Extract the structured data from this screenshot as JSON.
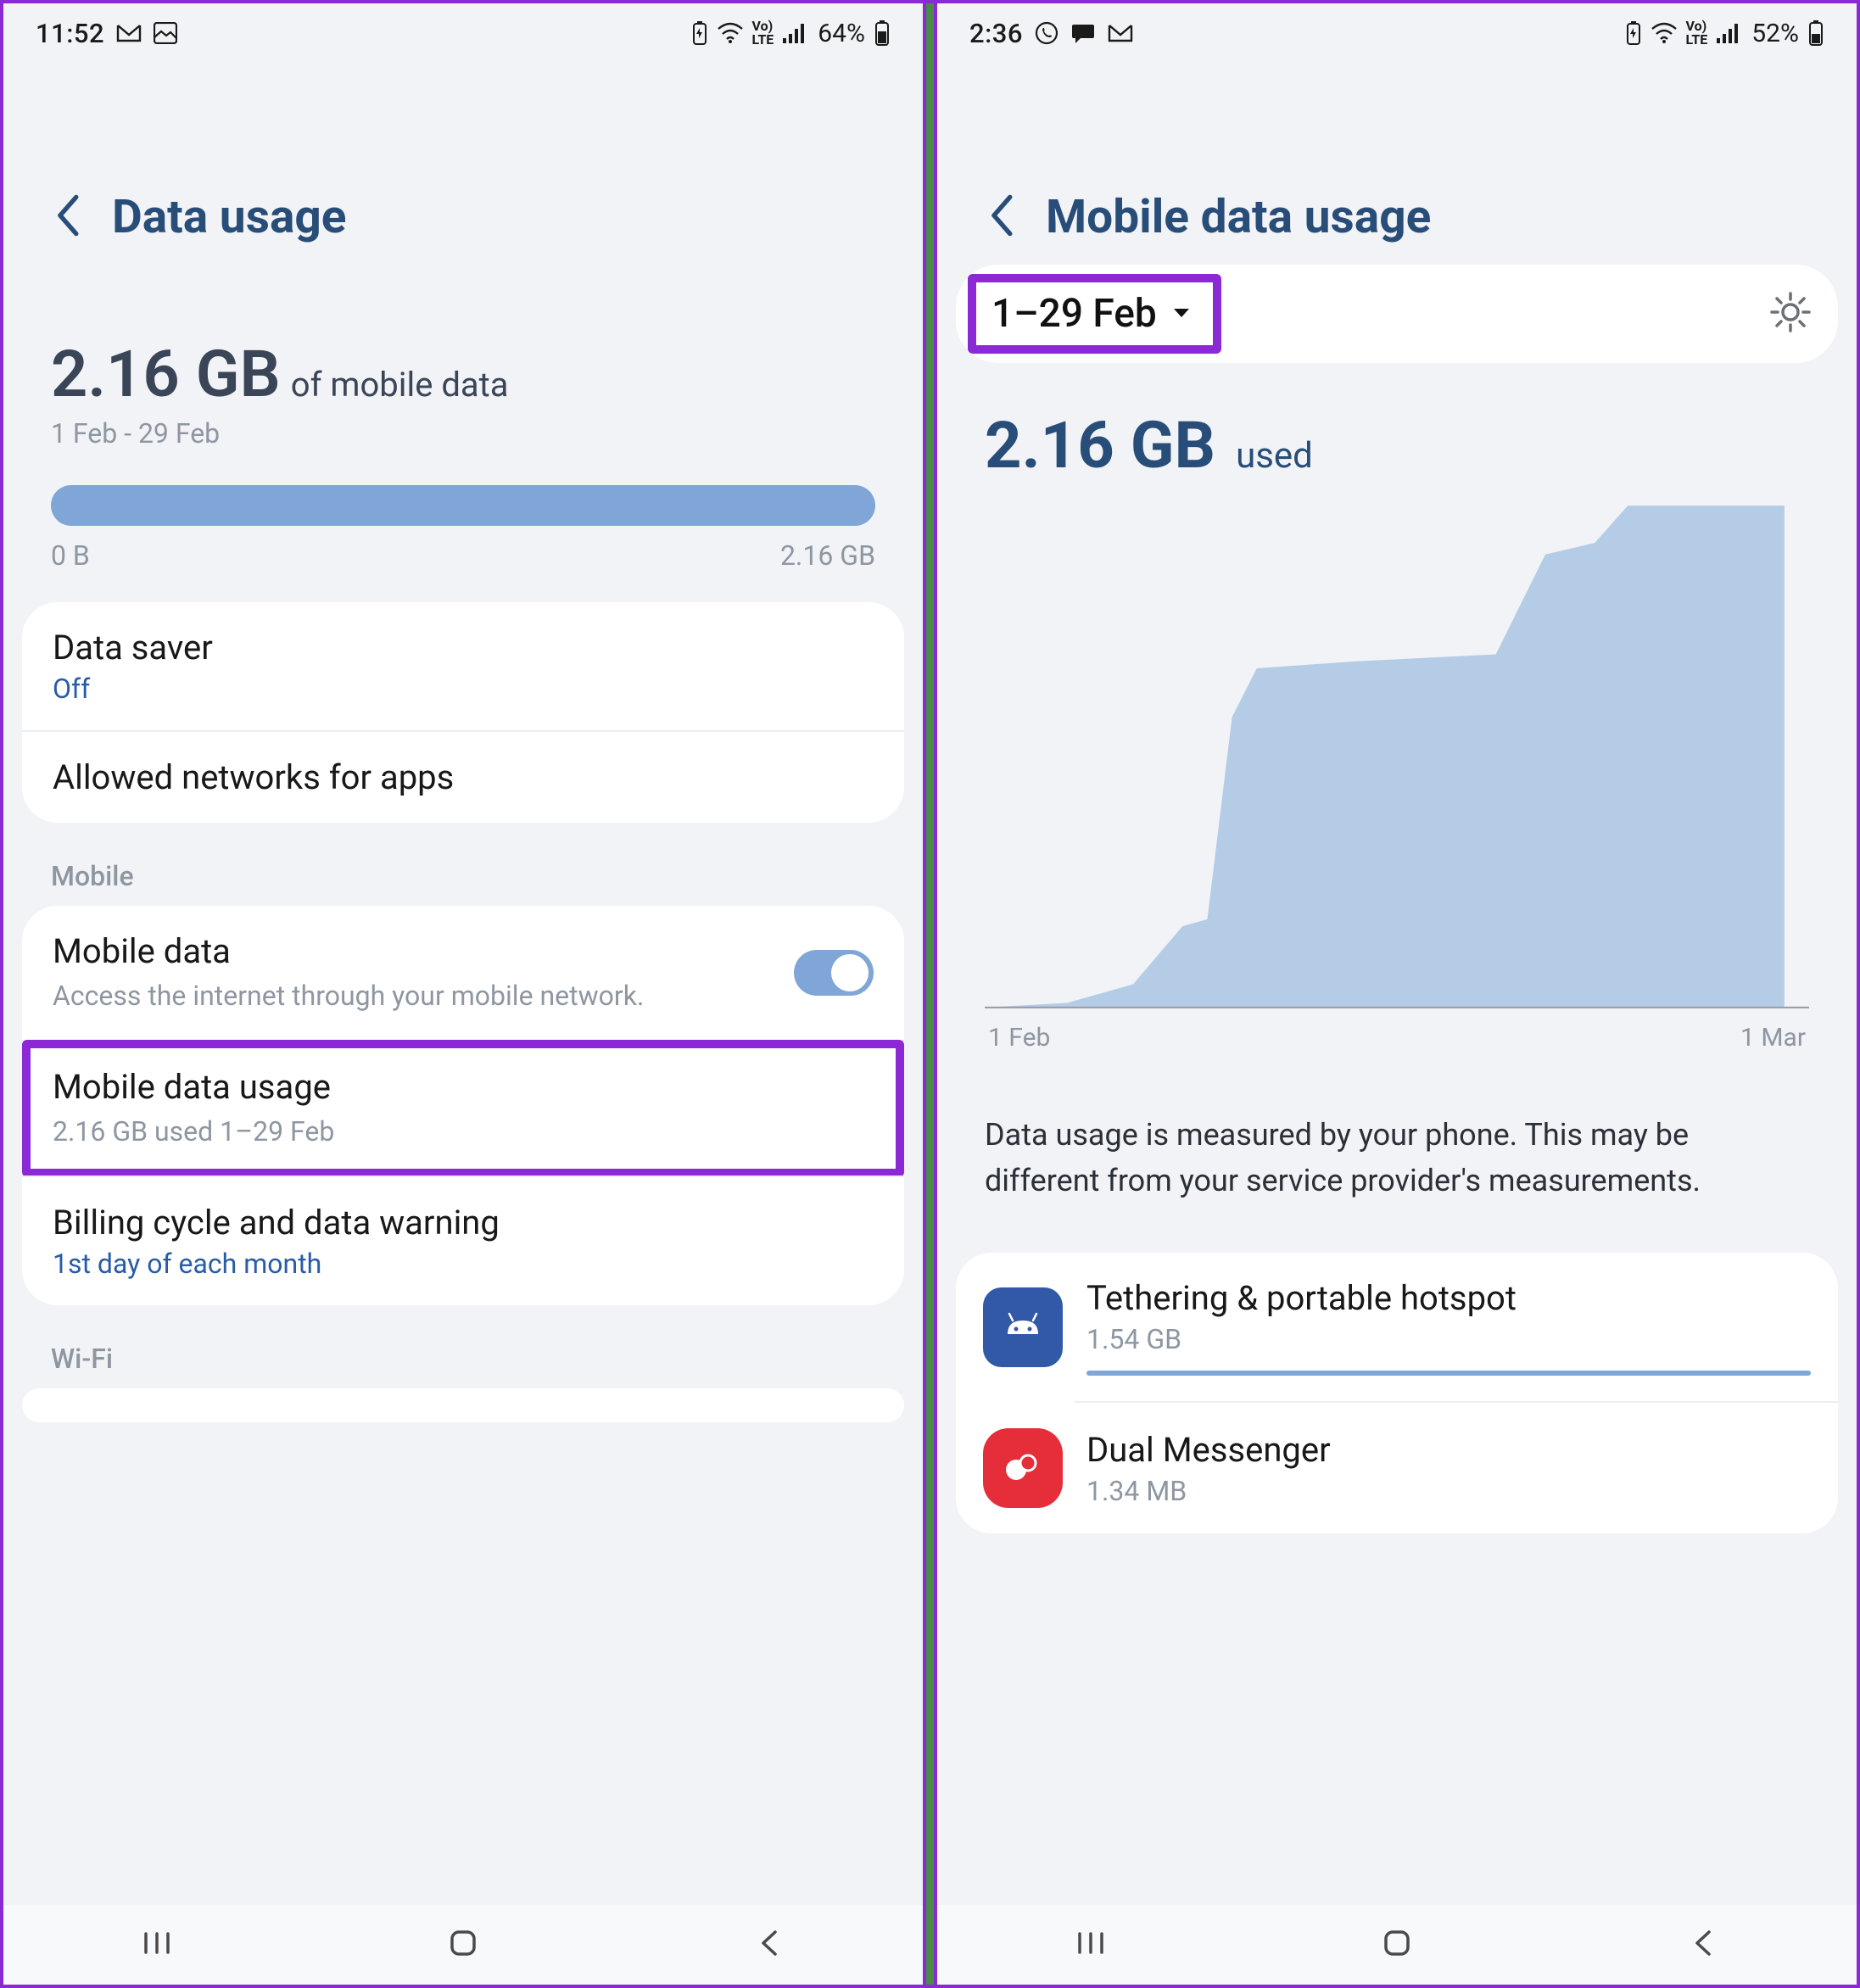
{
  "left": {
    "status": {
      "time": "11:52",
      "battery_pct": "64%"
    },
    "header_title": "Data usage",
    "summary": {
      "amount": "2.16 GB",
      "suffix": "of mobile data",
      "range": "1 Feb - 29 Feb",
      "min": "0 B",
      "max": "2.16 GB"
    },
    "card1": {
      "data_saver": {
        "title": "Data saver",
        "value": "Off"
      },
      "allowed": {
        "title": "Allowed networks for apps"
      }
    },
    "section_mobile": "Mobile",
    "card2": {
      "mobile_data": {
        "title": "Mobile data",
        "sub": "Access the internet through your mobile network."
      },
      "mobile_usage": {
        "title": "Mobile data usage",
        "sub": "2.16 GB used 1–29 Feb"
      },
      "billing": {
        "title": "Billing cycle and data warning",
        "sub": "1st day of each month"
      }
    },
    "section_wifi": "Wi-Fi"
  },
  "right": {
    "status": {
      "time": "2:36",
      "battery_pct": "52%"
    },
    "header_title": "Mobile data usage",
    "range_chip": "1–29 Feb",
    "used": {
      "amount": "2.16 GB",
      "suffix": "used"
    },
    "axis": {
      "start": "1 Feb",
      "end": "1 Mar"
    },
    "disclaimer": "Data usage is measured by your phone. This may be different from your service provider's measurements.",
    "apps": [
      {
        "name": "Tethering & portable hotspot",
        "amount": "1.54 GB",
        "icon": "android"
      },
      {
        "name": "Dual Messenger",
        "amount": "1.34 MB",
        "icon": "dual"
      }
    ]
  },
  "chart_data": {
    "type": "area",
    "title": "",
    "xlabel": "",
    "ylabel": "",
    "x_range": [
      "1 Feb",
      "1 Mar"
    ],
    "y_range_gb": [
      0,
      2.16
    ],
    "series": [
      {
        "name": "cumulative mobile data (GB)",
        "points": [
          {
            "x_frac": 0.0,
            "gb": 0.0
          },
          {
            "x_frac": 0.1,
            "gb": 0.02
          },
          {
            "x_frac": 0.18,
            "gb": 0.1
          },
          {
            "x_frac": 0.24,
            "gb": 0.35
          },
          {
            "x_frac": 0.27,
            "gb": 0.38
          },
          {
            "x_frac": 0.3,
            "gb": 1.25
          },
          {
            "x_frac": 0.33,
            "gb": 1.46
          },
          {
            "x_frac": 0.45,
            "gb": 1.49
          },
          {
            "x_frac": 0.62,
            "gb": 1.52
          },
          {
            "x_frac": 0.68,
            "gb": 1.95
          },
          {
            "x_frac": 0.74,
            "gb": 2.0
          },
          {
            "x_frac": 0.78,
            "gb": 2.16
          },
          {
            "x_frac": 0.97,
            "gb": 2.16
          }
        ]
      }
    ]
  }
}
